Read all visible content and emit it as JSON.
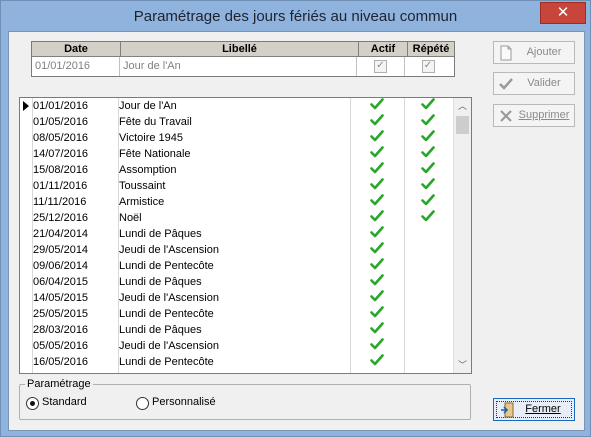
{
  "window": {
    "title": "Paramétrage des jours fériés au niveau commun",
    "close_glyph": "✕"
  },
  "edit_grid": {
    "columns": [
      "Date",
      "Libellé",
      "Actif",
      "Répété"
    ],
    "row": {
      "date": "01/01/2016",
      "libelle": "Jour de l'An",
      "actif": true,
      "repete": true
    }
  },
  "holidays": [
    {
      "date": "01/01/2016",
      "libelle": "Jour de l'An",
      "actif": true,
      "repete": true
    },
    {
      "date": "01/05/2016",
      "libelle": "Fête du Travail",
      "actif": true,
      "repete": true
    },
    {
      "date": "08/05/2016",
      "libelle": "Victoire 1945",
      "actif": true,
      "repete": true
    },
    {
      "date": "14/07/2016",
      "libelle": "Fête Nationale",
      "actif": true,
      "repete": true
    },
    {
      "date": "15/08/2016",
      "libelle": "Assomption",
      "actif": true,
      "repete": true
    },
    {
      "date": "01/11/2016",
      "libelle": "Toussaint",
      "actif": true,
      "repete": true
    },
    {
      "date": "11/11/2016",
      "libelle": "Armistice",
      "actif": true,
      "repete": true
    },
    {
      "date": "25/12/2016",
      "libelle": "Noël",
      "actif": true,
      "repete": true
    },
    {
      "date": "21/04/2014",
      "libelle": "Lundi de Pâques",
      "actif": true,
      "repete": false
    },
    {
      "date": "29/05/2014",
      "libelle": "Jeudi de l'Ascension",
      "actif": true,
      "repete": false
    },
    {
      "date": "09/06/2014",
      "libelle": "Lundi de Pentecôte",
      "actif": true,
      "repete": false
    },
    {
      "date": "06/04/2015",
      "libelle": "Lundi de Pâques",
      "actif": true,
      "repete": false
    },
    {
      "date": "14/05/2015",
      "libelle": "Jeudi de l'Ascension",
      "actif": true,
      "repete": false
    },
    {
      "date": "25/05/2015",
      "libelle": "Lundi de Pentecôte",
      "actif": true,
      "repete": false
    },
    {
      "date": "28/03/2016",
      "libelle": "Lundi de Pâques",
      "actif": true,
      "repete": false
    },
    {
      "date": "05/05/2016",
      "libelle": "Jeudi de l'Ascension",
      "actif": true,
      "repete": false
    },
    {
      "date": "16/05/2016",
      "libelle": "Lundi de Pentecôte",
      "actif": true,
      "repete": false
    }
  ],
  "selected_index": 0,
  "buttons": {
    "ajouter": "Ajouter",
    "valider": "Valider",
    "supprimer": "Supprimer",
    "fermer": "Fermer"
  },
  "parametrage": {
    "label": "Paramétrage",
    "options": [
      "Standard",
      "Personnalisé"
    ],
    "selected": "Standard"
  },
  "colors": {
    "check_green": "#2aa52a",
    "title_bar": "#8fb3dc",
    "close_red": "#c7453b"
  }
}
